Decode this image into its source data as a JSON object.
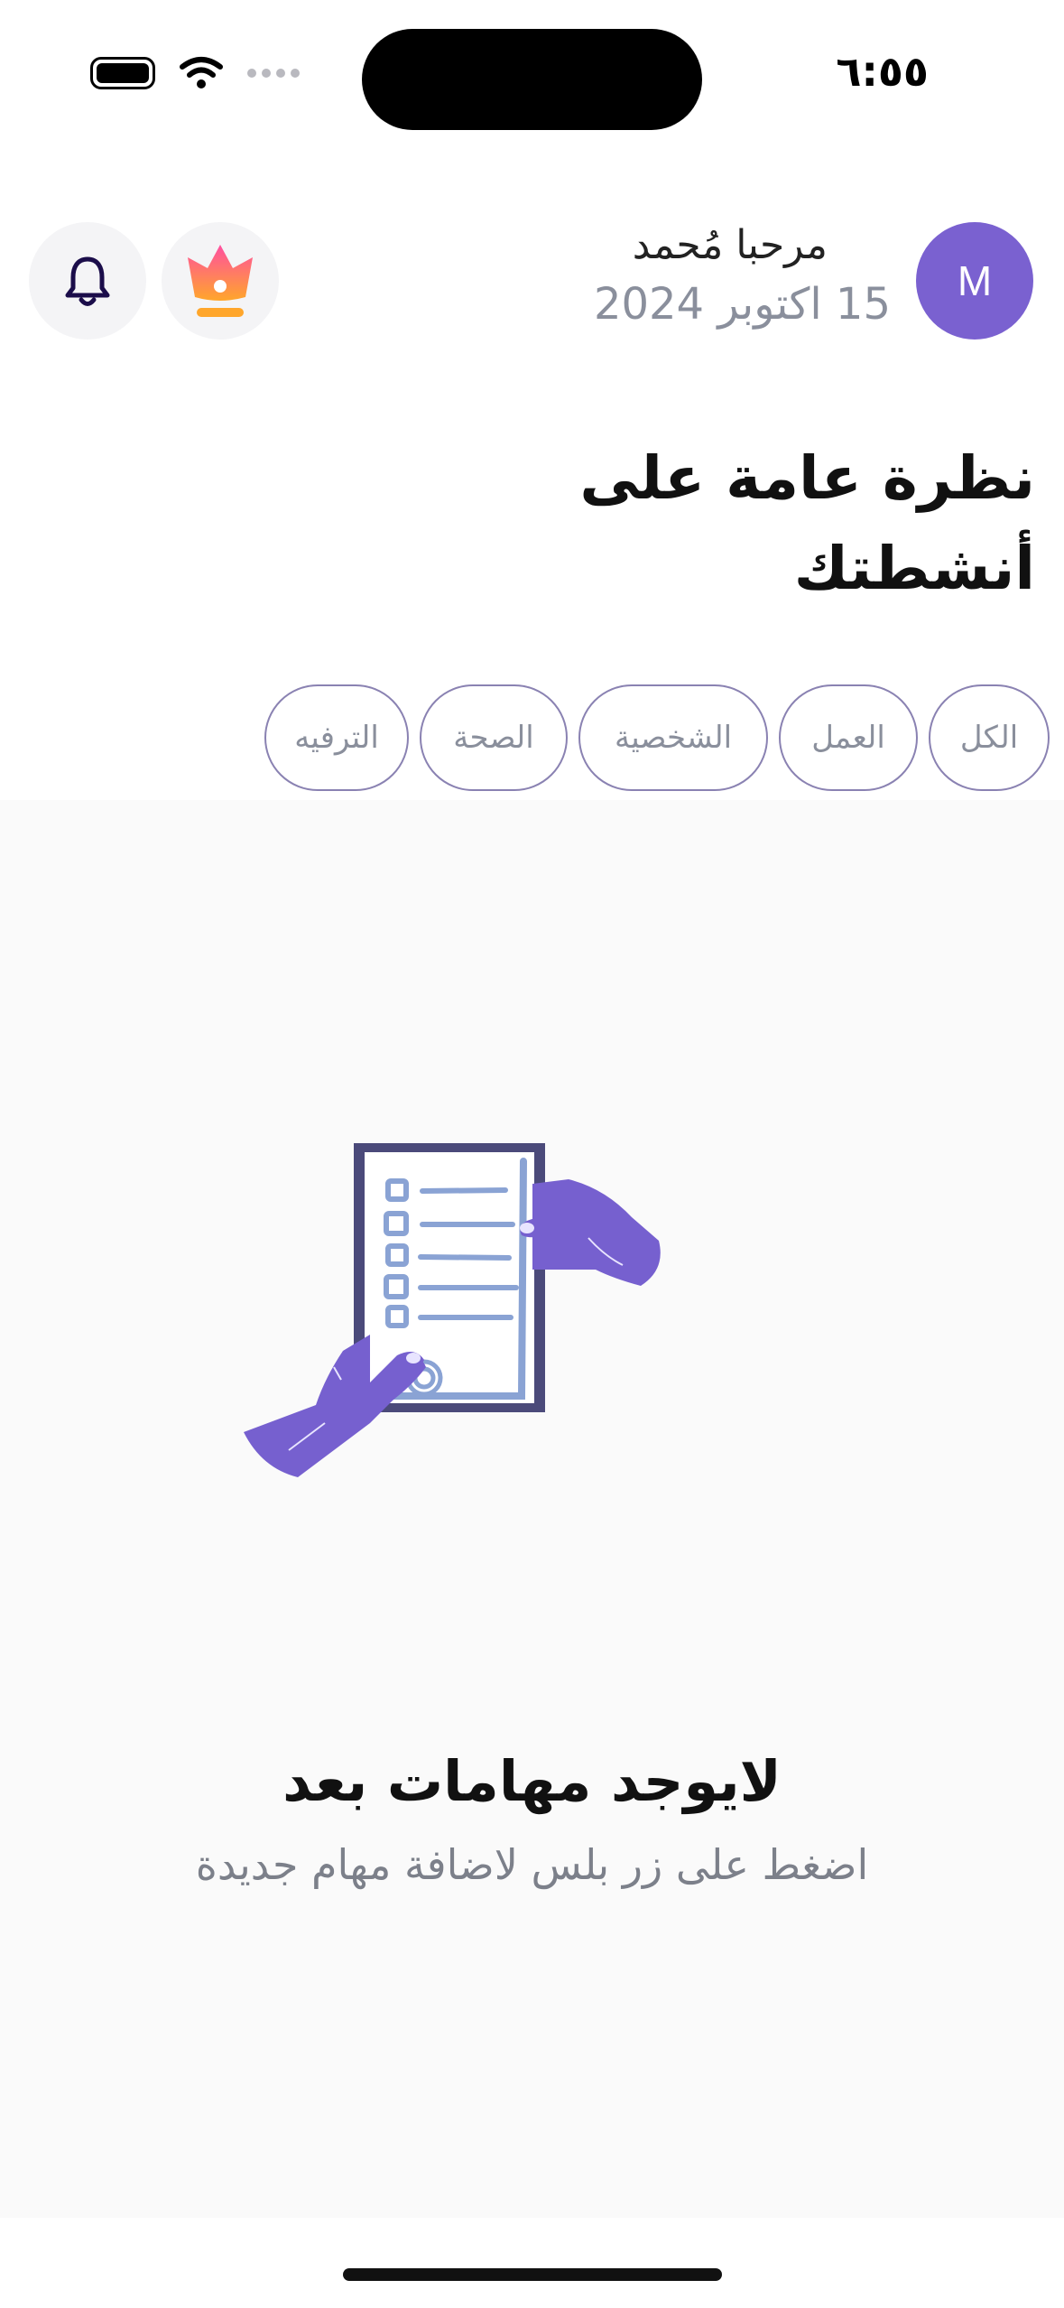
{
  "status_bar": {
    "time": "٦:٥٥"
  },
  "header": {
    "avatar_initial": "M",
    "greeting": "مرحبا مُحمد",
    "date": "15 اكتوبر 2024"
  },
  "page_title": "نظرة عامة على أنشطتك",
  "filters": [
    {
      "label": "الكل"
    },
    {
      "label": "العمل"
    },
    {
      "label": "الشخصية"
    },
    {
      "label": "الصحة"
    },
    {
      "label": "الترفيه"
    }
  ],
  "empty_state": {
    "title": "لايوجد مهامات بعد",
    "subtitle": "اضغط على زر بلس لاضافة مهام جديدة"
  },
  "colors": {
    "accent": "#7a61d0",
    "chip_border": "#8a82b2",
    "muted_text": "#8a8f9c",
    "background_soft": "#fafafa"
  }
}
